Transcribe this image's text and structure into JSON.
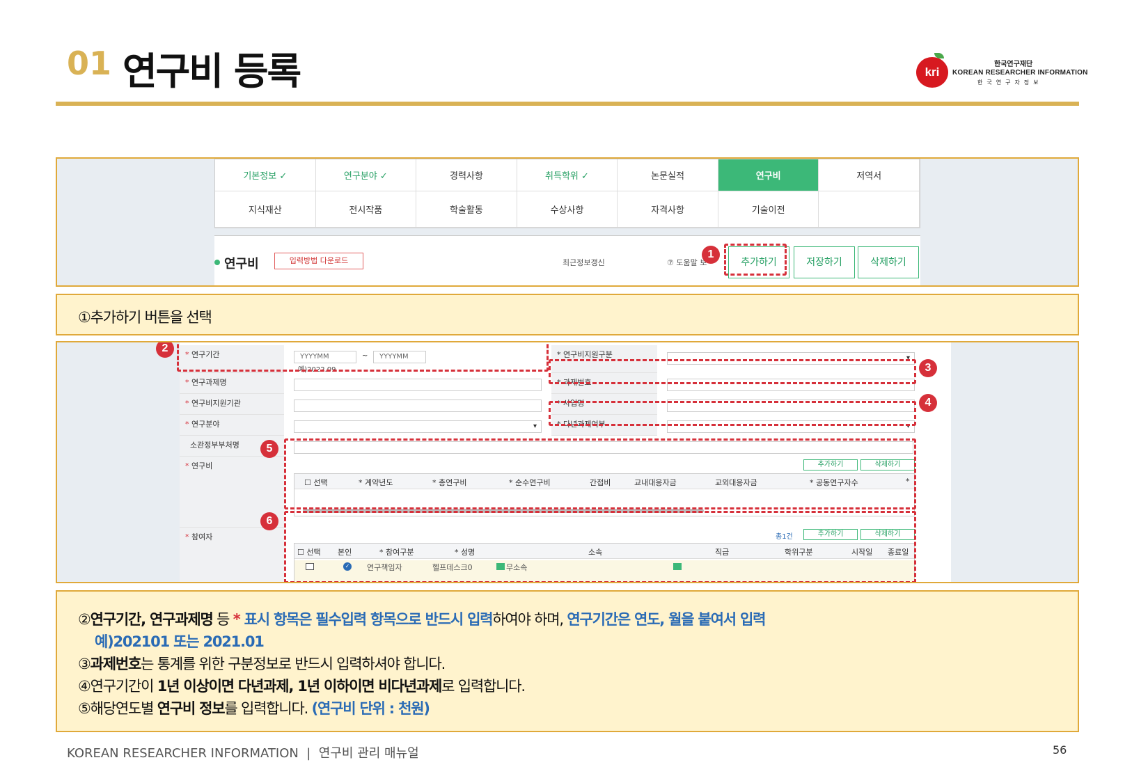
{
  "header": {
    "number": "01",
    "title": "연구비 등록"
  },
  "logo": {
    "mark": "kri",
    "org_ko": "한국연구재단",
    "org_en": "KOREAN RESEARCHER INFORMATION",
    "org_sub": "한국연구자정보"
  },
  "tabs": [
    "기본정보 ✓",
    "연구분야 ✓",
    "경력사항",
    "취득학위 ✓",
    "논문실적",
    "연구비",
    "저역서",
    "지식재산",
    "전시작품",
    "학술활동",
    "수상사항",
    "자격사항",
    "기술이전",
    ""
  ],
  "section": {
    "title": "연구비",
    "download": "입력방법 다운로드",
    "recent": "최근정보갱신",
    "help": "⑦ 도움말 보",
    "add": "추가하기",
    "save": "저장하기",
    "delete": "삭제하기"
  },
  "badges": [
    "1",
    "2",
    "3",
    "4",
    "5",
    "6"
  ],
  "note1": "①추가하기 버튼을 선택",
  "form": {
    "period": "연구기간",
    "yyyymm1": "YYYYMM",
    "tilde": "~",
    "yyyymm2": "YYYYMM",
    "example": "예)2022.09",
    "support_type": "연구비지원구분",
    "project_name": "연구과제명",
    "project_no": "과제번호",
    "agency": "연구비지원기관",
    "biz_name": "사업명",
    "field": "연구분야",
    "multi_year": "다년과제여부",
    "ministry": "소관정부부처명",
    "funding": "연구비",
    "participants": "참여자",
    "mini_add": "추가하기",
    "mini_del": "삭제하기",
    "total": "총1건",
    "fund_cols": [
      "☐ 선택",
      "* 계약년도",
      "* 총연구비",
      "* 순수연구비",
      "간접비",
      "교내대응자금",
      "교외대응자금",
      "* 공동연구자수",
      "*"
    ],
    "part_cols": [
      "☐ 선택",
      "본인",
      "* 참여구분",
      "* 성명",
      "소속",
      "직급",
      "학위구분",
      "시작일",
      "종료일"
    ],
    "part_row": {
      "role": "연구책임자",
      "name": "헬프데스크0",
      "affil": "무소속"
    }
  },
  "note2": {
    "l1a": "②",
    "l1b": "연구기간, 연구과제명",
    "l1c": " 등 ",
    "l1d": "*",
    "l1e": " 표시 항목은 필수입력 항목으로 반드시 입력",
    "l1f": "하여야 하며, ",
    "l1g": "연구기간은 연도, 월을 붙여서 입력",
    "l2": "예)202101 또는 2021.01",
    "l3a": "③",
    "l3b": "과제번호",
    "l3c": "는 통계를 위한 구분정보로 반드시 입력하셔야 합니다.",
    "l4a": "④연구기간이 ",
    "l4b": "1년 이상이면 다년과제, 1년 이하이면 비다년과제",
    "l4c": "로 입력합니다.",
    "l5a": "⑤해당연도별 ",
    "l5b": "연구비 정보",
    "l5c": "를 입력합니다. ",
    "l5d": "(연구비 단위 : 천원)"
  },
  "footer": {
    "left": "KOREAN RESEARCHER INFORMATION  |  연구비 관리 매뉴얼",
    "page": "56"
  }
}
